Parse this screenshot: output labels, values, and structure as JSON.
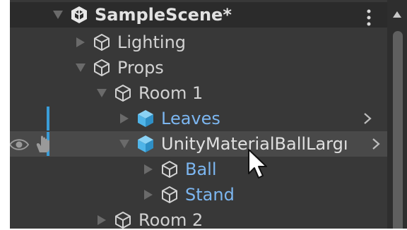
{
  "hierarchy": {
    "scene": {
      "name": "SampleScene*",
      "icon": "unity-scene-icon",
      "menu_icon": "kebab-menu-icon"
    },
    "items": [
      {
        "label": "Lighting",
        "icon": "gameobject-cube-icon",
        "expanded": false,
        "prefab": false
      },
      {
        "label": "Props",
        "icon": "gameobject-cube-icon",
        "expanded": true,
        "prefab": false
      },
      {
        "label": "Room 1",
        "icon": "gameobject-cube-icon",
        "expanded": true,
        "prefab": false
      },
      {
        "label": "Leaves",
        "icon": "prefab-cube-icon",
        "expanded": false,
        "prefab": true,
        "has_children_indicator": true,
        "modified": true
      },
      {
        "label": "UnityMaterialBallLarge",
        "visible_label": "UnityMaterialBallLargı",
        "icon": "prefab-cube-icon",
        "expanded": true,
        "prefab": false,
        "selected": true,
        "has_children_indicator": true,
        "modified": true
      },
      {
        "label": "Ball",
        "icon": "gameobject-cube-icon",
        "expanded": false,
        "prefab": true
      },
      {
        "label": "Stand",
        "icon": "gameobject-cube-icon",
        "expanded": false,
        "prefab": true
      },
      {
        "label": "Room 2",
        "icon": "gameobject-cube-icon",
        "expanded": false,
        "prefab": false
      }
    ]
  },
  "gutter": {
    "visibility_icon": "eye-icon",
    "pickability_icon": "hand-icon"
  },
  "colors": {
    "panel_bg": "#383838",
    "header_bg": "#2b2b2b",
    "selected_row_bg": "#494949",
    "text": "#d2d2d2",
    "prefab_text": "#7cb6f0",
    "prefab_icon": "#4fb4e8",
    "modified_bar": "#3a9dd8"
  }
}
